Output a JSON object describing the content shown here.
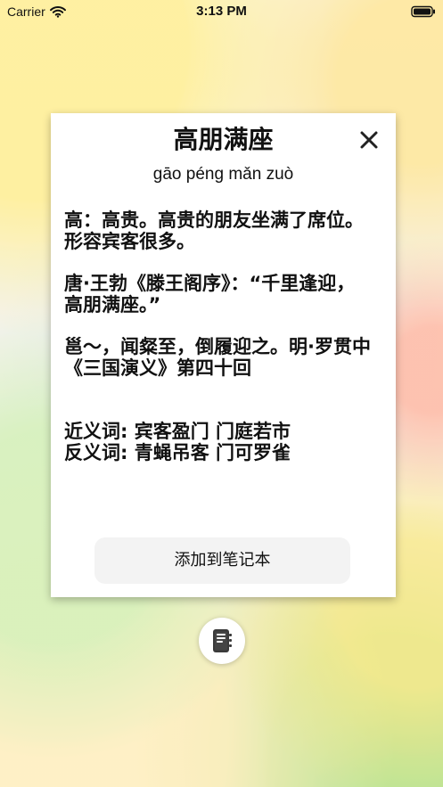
{
  "status_bar": {
    "carrier": "Carrier",
    "time": "3:13 PM",
    "wifi_icon": "wifi-icon",
    "battery_icon": "battery-icon"
  },
  "modal": {
    "title": "高朋满座",
    "pinyin": "gāo péng mǎn zuò",
    "close_icon": "close-icon",
    "definition": "高：高贵。高贵的朋友坐满了席位。形容宾客很多。",
    "source": "唐·王勃《滕王阁序》：“千里逢迎，高朋满座。”",
    "example": "邕～，闻粲至，倒履迎之。明·罗贯中《三国演义》第四十回",
    "synonyms": "近义词: 宾客盈门 门庭若市",
    "antonyms": "反义词: 青蝇吊客 门可罗雀",
    "add_button_label": "添加到笔记本"
  },
  "floating_button": {
    "icon": "notebook-icon"
  },
  "colors": {
    "text": "#111111",
    "card_background": "#ffffff",
    "button_background": "#f3f3f3"
  }
}
